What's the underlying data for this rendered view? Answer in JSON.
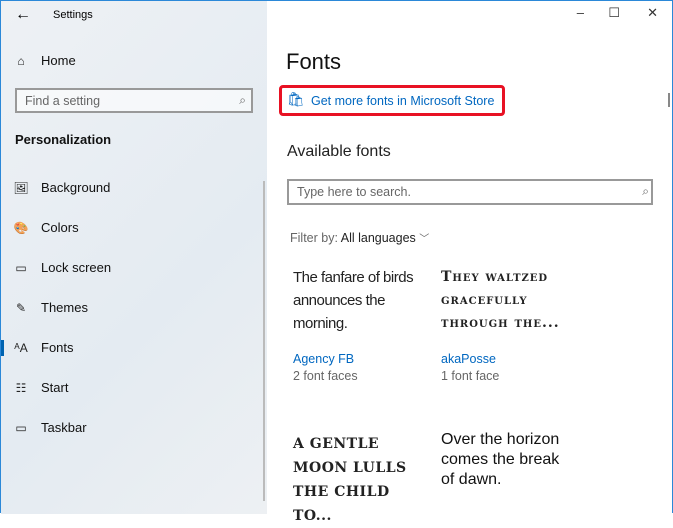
{
  "window": {
    "title": "Settings",
    "back_icon": "arrow-left-icon",
    "minimize": "–",
    "maximize": "☐",
    "close": "✕"
  },
  "sidebar": {
    "home": "Home",
    "search_placeholder": "Find a setting",
    "section": "Personalization",
    "items": [
      {
        "label": "Background",
        "icon": "🖼"
      },
      {
        "label": "Colors",
        "icon": "🎨"
      },
      {
        "label": "Lock screen",
        "icon": "▭"
      },
      {
        "label": "Themes",
        "icon": "✎"
      },
      {
        "label": "Fonts",
        "icon": "ᴬA"
      },
      {
        "label": "Start",
        "icon": "☷"
      },
      {
        "label": "Taskbar",
        "icon": "▭"
      }
    ],
    "selected": "Fonts"
  },
  "main": {
    "title": "Fonts",
    "store_link": "Get more fonts in Microsoft Store",
    "available_heading": "Available fonts",
    "search_placeholder": "Type here to search.",
    "filter_label": "Filter by:",
    "filter_value": "All languages",
    "fonts": [
      {
        "preview": "The fanfare of birds announces the morning.",
        "name": "Agency FB",
        "faces": "2 font faces"
      },
      {
        "preview": "They waltzed gracefully through the...",
        "name": "akaPosse",
        "faces": "1 font face"
      },
      {
        "preview": "A gentle moon lulls the child to...",
        "name": "",
        "faces": ""
      },
      {
        "preview": "Over the horizon comes the break of dawn.",
        "name": "",
        "faces": ""
      }
    ],
    "highlight_color": "#e81123"
  }
}
